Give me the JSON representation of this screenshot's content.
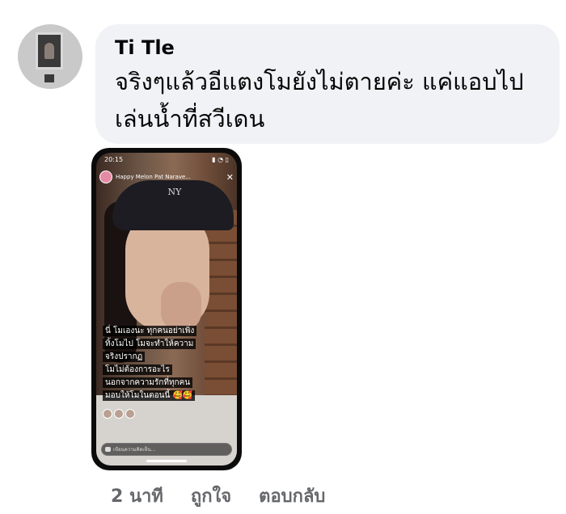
{
  "comment": {
    "author": "Ti Tle",
    "text": "จริงๆแล้วอีแตงโมยังไม่ตายค่ะ แค่แอบไป\nเล่นน้ำที่สวีเดน"
  },
  "story": {
    "status_time": "20:15",
    "account_name": "Happy Melon Pat Narave...",
    "caption_lines": [
      "นี่ โมเองนะ ทุกคนอย่าเพิ่ง",
      "ทิ้งโมไป โมจะทำให้ความ",
      "จริงปรากฏ",
      "โมไม่ต้องการอะไร",
      "นอกจากความรักที่ทุกคน",
      "มอบให้โมในตอนนี้ 🥰🥰"
    ],
    "reply_placeholder": "เขียนความคิดเห็น...",
    "cap_logo": "NY"
  },
  "actions": {
    "time": "2 นาที",
    "like": "ถูกใจ",
    "reply": "ตอบกลับ"
  },
  "colors": {
    "bubble_bg": "#f0f2f5",
    "meta_text": "#65676b"
  },
  "icons": [
    "close-icon",
    "chat-icon"
  ]
}
